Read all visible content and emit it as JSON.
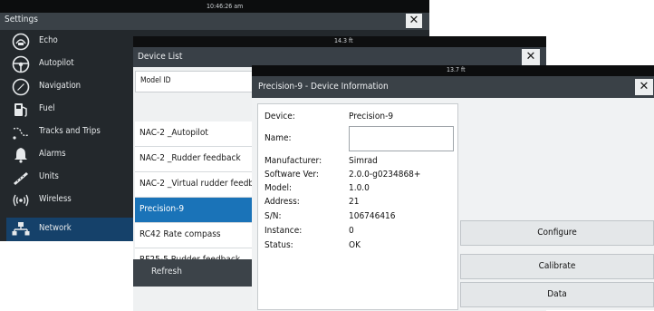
{
  "settings": {
    "clock": "10:46:26 am",
    "title": "Settings",
    "close": "✕",
    "items": [
      {
        "label": "Echo",
        "icon": "echo-icon"
      },
      {
        "label": "Autopilot",
        "icon": "autopilot-wheel-icon"
      },
      {
        "label": "Navigation",
        "icon": "compass-icon"
      },
      {
        "label": "Fuel",
        "icon": "fuel-pump-icon"
      },
      {
        "label": "Tracks and Trips",
        "icon": "tracks-icon"
      },
      {
        "label": "Alarms",
        "icon": "bell-icon"
      },
      {
        "label": "Units",
        "icon": "units-ruler-icon"
      },
      {
        "label": "Wireless",
        "icon": "wireless-icon"
      },
      {
        "label": "Network",
        "icon": "network-icon"
      }
    ],
    "selected": "Network"
  },
  "device_list": {
    "depth": "14.3 ft",
    "title": "Device List",
    "close": "✕",
    "column_header": "Model ID",
    "rows": [
      "NAC-2 _Autopilot",
      "NAC-2 _Rudder feedback",
      "NAC-2 _Virtual rudder feedb",
      "Precision-9",
      "RC42 Rate compass",
      "RF25-5 Rudder feedback"
    ],
    "selected_row": "Precision-9",
    "refresh": "Refresh"
  },
  "device_info": {
    "depth": "13.7 ft",
    "title": "Precision-9 - Device Information",
    "close": "✕",
    "fields": {
      "device_label": "Device:",
      "device_value": "Precision-9",
      "name_label": "Name:",
      "name_value": "",
      "manufacturer_label": "Manufacturer:",
      "manufacturer_value": "Simrad",
      "software_label": "Software Ver:",
      "software_value": "2.0.0-g0234868+",
      "model_label": "Model:",
      "model_value": "1.0.0",
      "address_label": "Address:",
      "address_value": "21",
      "sn_label": "S/N:",
      "sn_value": "106746416",
      "instance_label": "Instance:",
      "instance_value": "0",
      "status_label": "Status:",
      "status_value": "OK"
    },
    "buttons": {
      "configure": "Configure",
      "calibrate": "Calibrate",
      "data": "Data"
    }
  }
}
